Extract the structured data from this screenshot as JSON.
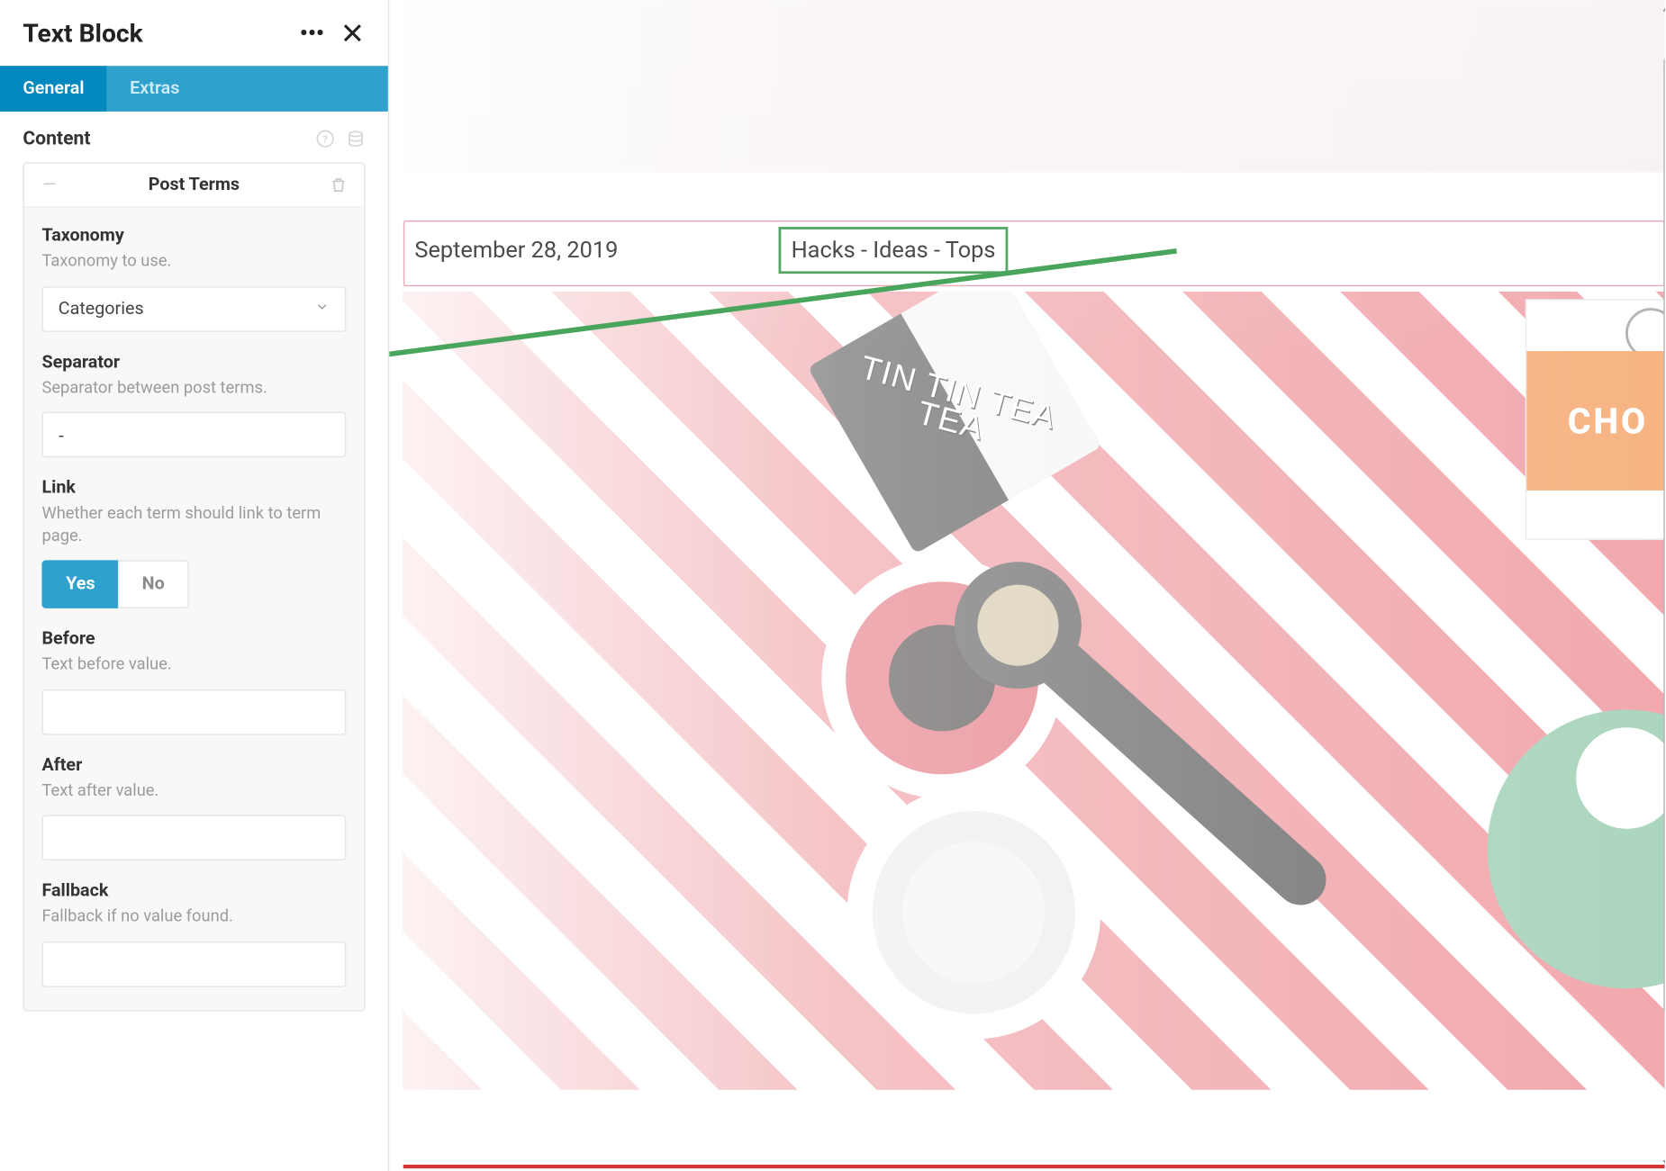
{
  "panel": {
    "title": "Text Block",
    "tabs": {
      "general": "General",
      "extras": "Extras"
    },
    "section": "Content",
    "card_title": "Post Terms",
    "fields": {
      "taxonomy": {
        "label": "Taxonomy",
        "desc": "Taxonomy to use.",
        "value": "Categories"
      },
      "separator": {
        "label": "Separator",
        "desc": "Separator between post terms.",
        "value": "-"
      },
      "link": {
        "label": "Link",
        "desc": "Whether each term should link to term page.",
        "yes": "Yes",
        "no": "No"
      },
      "before": {
        "label": "Before",
        "desc": "Text before value.",
        "value": ""
      },
      "after": {
        "label": "After",
        "desc": "Text after value.",
        "value": ""
      },
      "fallback": {
        "label": "Fallback",
        "desc": "Fallback if no value found.",
        "value": ""
      }
    }
  },
  "preview": {
    "date": "September 28, 2019",
    "terms": "Hacks - Ideas - Tops",
    "choc_label": "CHO",
    "tin_label": "TIN TIN\nTEA TEA"
  }
}
